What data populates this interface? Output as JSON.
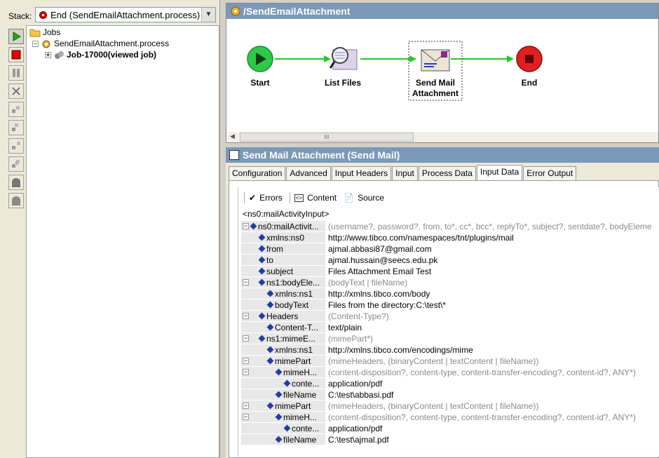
{
  "stack": {
    "label": "Stack:",
    "value": "End (SendEmailAttachment.process)"
  },
  "toolbar_icons": [
    "play-icon",
    "stop-icon",
    "pause-icon",
    "kill-icon",
    "step-icon",
    "step-into-icon",
    "step-out-icon",
    "step-next-icon",
    "breakpoint-icon",
    "breakpoint-clear-icon"
  ],
  "tree": {
    "root": "Jobs",
    "process": "SendEmailAttachment.process",
    "job": "Job-17000(viewed job)"
  },
  "process_panel": {
    "title": "/SendEmailAttachment",
    "nodes": [
      {
        "label": "Start",
        "icon": "start-icon"
      },
      {
        "label": "List Files",
        "icon": "list-files-icon"
      },
      {
        "label": "Send Mail Attachment",
        "icon": "send-mail-icon"
      },
      {
        "label": "End",
        "icon": "end-icon"
      }
    ],
    "scroll_thumb": "III"
  },
  "props": {
    "title": "Send Mail Attachment (Send Mail)",
    "tabs": [
      "Configuration",
      "Advanced",
      "Input Headers",
      "Input",
      "Process Data",
      "Input Data",
      "Error Output"
    ],
    "active_tab": "Input Data",
    "mapper_toolbar": {
      "errors": "Errors",
      "content": "Content",
      "source": "Source"
    },
    "root_element": "<ns0:mailActivityInput>",
    "rows": [
      {
        "name": "ns0:mailActivit...",
        "value": "(username?, password?, from, to*, cc*, bcc*, replyTo*, subject?, sentdate?, bodyEleme",
        "hint": true,
        "level": 0,
        "exp": true
      },
      {
        "name": "xmlns:ns0",
        "value": "http://www.tibco.com/namespaces/tnt/plugins/mail",
        "hint": false,
        "level": 1,
        "exp": false
      },
      {
        "name": "from",
        "value": "ajmal.abbasi87@gmail.com",
        "hint": false,
        "level": 1,
        "exp": false
      },
      {
        "name": "to",
        "value": "ajmal.hussain@seecs.edu.pk",
        "hint": false,
        "level": 1,
        "exp": false
      },
      {
        "name": "subject",
        "value": "Files Attachment Email Test",
        "hint": false,
        "level": 1,
        "exp": false
      },
      {
        "name": "ns1:bodyEle...",
        "value": "(bodyText | fileName)",
        "hint": true,
        "level": 1,
        "exp": true
      },
      {
        "name": "xmlns:ns1",
        "value": "http://xmlns.tibco.com/body",
        "hint": false,
        "level": 2,
        "exp": false
      },
      {
        "name": "bodyText",
        "value": "Files from the directory:C:\\test\\*",
        "hint": false,
        "level": 2,
        "exp": false
      },
      {
        "name": "Headers",
        "value": "(Content-Type?)",
        "hint": true,
        "level": 1,
        "exp": true
      },
      {
        "name": "Content-T...",
        "value": "text/plain",
        "hint": false,
        "level": 2,
        "exp": false
      },
      {
        "name": "ns1:mimeE...",
        "value": "(mimePart*)",
        "hint": true,
        "level": 1,
        "exp": true
      },
      {
        "name": "xmlns:ns1",
        "value": "http://xmlns.tibco.com/encodings/mime",
        "hint": false,
        "level": 2,
        "exp": false
      },
      {
        "name": "mimePart",
        "value": "(mimeHeaders, (binaryContent | textContent | fileName))",
        "hint": true,
        "level": 2,
        "exp": true
      },
      {
        "name": "mimeH...",
        "value": "(content-disposition?, content-type, content-transfer-encoding?, content-id?, ANY*)",
        "hint": true,
        "level": 3,
        "exp": true
      },
      {
        "name": "conte...",
        "value": "application/pdf",
        "hint": false,
        "level": 4,
        "exp": false
      },
      {
        "name": "fileName",
        "value": "C:\\test\\abbasi.pdf",
        "hint": false,
        "level": 3,
        "exp": false
      },
      {
        "name": "mimePart",
        "value": "(mimeHeaders, (binaryContent | textContent | fileName))",
        "hint": true,
        "level": 2,
        "exp": true
      },
      {
        "name": "mimeH...",
        "value": "(content-disposition?, content-type, content-transfer-encoding?, content-id?, ANY*)",
        "hint": true,
        "level": 3,
        "exp": true
      },
      {
        "name": "conte...",
        "value": "application/pdf",
        "hint": false,
        "level": 4,
        "exp": false
      },
      {
        "name": "fileName",
        "value": "C:\\test\\ajmal.pdf",
        "hint": false,
        "level": 3,
        "exp": false
      }
    ]
  },
  "colors": {
    "titlebar": "#7b98b7",
    "arrow": "#22cc22",
    "start": "#2fc94a",
    "end": "#e02020",
    "marker": "#2040a0"
  }
}
